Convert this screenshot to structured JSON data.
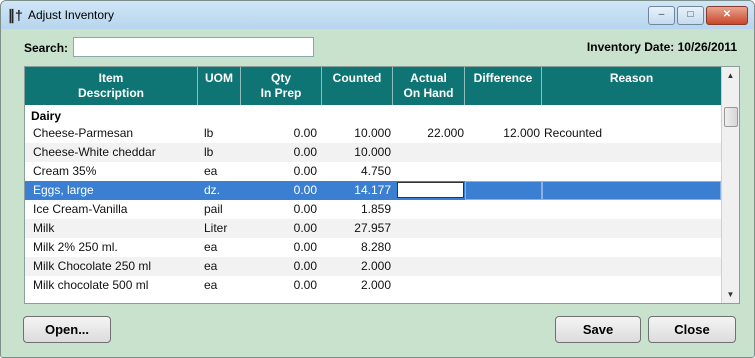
{
  "window": {
    "title": "Adjust Inventory",
    "app_icon": "utensils-icon"
  },
  "search": {
    "label": "Search:",
    "value": "",
    "placeholder": ""
  },
  "inventory_date": "Inventory Date: 10/26/2011",
  "columns": [
    "Item\nDescription",
    "UOM",
    "Qty\nIn Prep",
    "Counted",
    "Actual\nOn Hand",
    "Difference",
    "Reason"
  ],
  "group": "Dairy",
  "rows": [
    {
      "description": "Cheese-Parmesan",
      "uom": "lb",
      "qty_in_prep": "0.00",
      "counted": "10.000",
      "actual_on_hand": "22.000",
      "difference": "12.000",
      "reason": "Recounted"
    },
    {
      "description": "Cheese-White cheddar",
      "uom": "lb",
      "qty_in_prep": "0.00",
      "counted": "10.000",
      "actual_on_hand": "",
      "difference": "",
      "reason": ""
    },
    {
      "description": "Cream 35%",
      "uom": "ea",
      "qty_in_prep": "0.00",
      "counted": "4.750",
      "actual_on_hand": "",
      "difference": "",
      "reason": ""
    },
    {
      "description": "Eggs, large",
      "uom": "dz.",
      "qty_in_prep": "0.00",
      "counted": "14.177",
      "actual_on_hand": "",
      "difference": "",
      "reason": ""
    },
    {
      "description": "Ice Cream-Vanilla",
      "uom": "pail",
      "qty_in_prep": "0.00",
      "counted": "1.859",
      "actual_on_hand": "",
      "difference": "",
      "reason": ""
    },
    {
      "description": "Milk",
      "uom": "Liter",
      "qty_in_prep": "0.00",
      "counted": "27.957",
      "actual_on_hand": "",
      "difference": "",
      "reason": ""
    },
    {
      "description": "Milk 2% 250 ml.",
      "uom": "ea",
      "qty_in_prep": "0.00",
      "counted": "8.280",
      "actual_on_hand": "",
      "difference": "",
      "reason": ""
    },
    {
      "description": "Milk Chocolate 250 ml",
      "uom": "ea",
      "qty_in_prep": "0.00",
      "counted": "2.000",
      "actual_on_hand": "",
      "difference": "",
      "reason": ""
    },
    {
      "description": "Milk chocolate 500 ml",
      "uom": "ea",
      "qty_in_prep": "0.00",
      "counted": "2.000",
      "actual_on_hand": "",
      "difference": "",
      "reason": ""
    }
  ],
  "selected_row": 3,
  "buttons": {
    "open": "Open...",
    "save": "Save",
    "close": "Close"
  },
  "colors": {
    "header": "#0f7474",
    "background": "#c9e2cd",
    "selection": "#3b7fd3"
  }
}
